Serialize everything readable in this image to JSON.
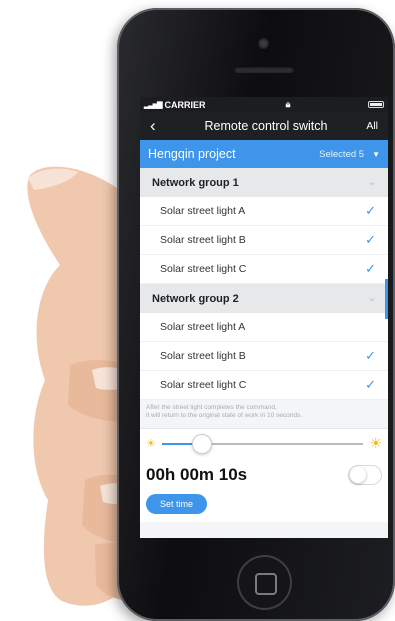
{
  "status_bar": {
    "carrier": "CARRIER"
  },
  "nav": {
    "title": "Remote control switch",
    "all_label": "All"
  },
  "project": {
    "name": "Hengqin project",
    "selected": "Selected 5"
  },
  "groups": [
    {
      "name": "Network group 1",
      "items": [
        {
          "label": "Solar street light A",
          "checked": true
        },
        {
          "label": "Solar street light B",
          "checked": true
        },
        {
          "label": "Solar street light C",
          "checked": true
        }
      ]
    },
    {
      "name": "Network group 2",
      "items": [
        {
          "label": "Solar street light A",
          "checked": false
        },
        {
          "label": "Solar street light B",
          "checked": true
        },
        {
          "label": "Solar street light C",
          "checked": true
        }
      ]
    }
  ],
  "note": {
    "line1": "After the street light completes the command,",
    "line2": "it will return to the original state of work in 10 seconds."
  },
  "brightness": {
    "level": 0.2
  },
  "timer": {
    "value": "00h 00m 10s",
    "enabled": false,
    "set_label": "Set time"
  },
  "colors": {
    "accent": "#3e95ea",
    "sun": "#f2b61f"
  },
  "icons": {
    "check": "check-icon",
    "back": "back-arrow-icon",
    "sun": "sun-icon"
  }
}
